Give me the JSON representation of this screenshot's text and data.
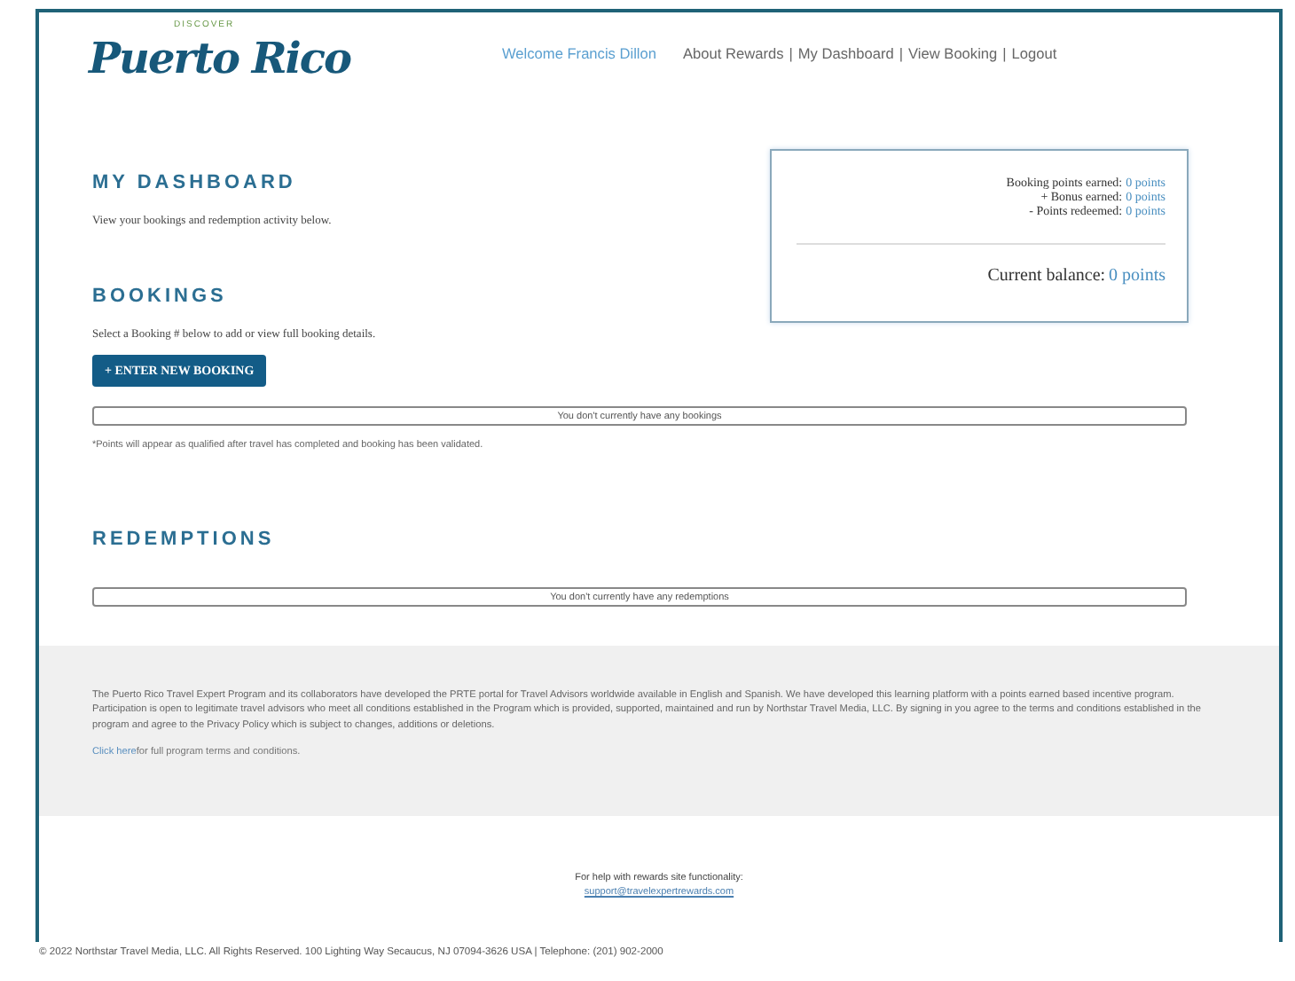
{
  "header": {
    "logo_small": "DISCOVER",
    "logo": "Puerto Rico",
    "welcome": "Welcome Francis Dillon",
    "separator": "|",
    "nav": [
      {
        "label": "About Rewards"
      },
      {
        "label": "My Dashboard"
      },
      {
        "label": "View Booking"
      },
      {
        "label": "Logout"
      }
    ]
  },
  "dashboard": {
    "title": "MY DASHBOARD",
    "text": "View your bookings and redemption activity below."
  },
  "points": {
    "rows": [
      {
        "label": "Booking points earned:",
        "value": "0 points"
      },
      {
        "label": "+ Bonus earned:",
        "value": "0 points"
      },
      {
        "label": "- Points redeemed:",
        "value": "0 points"
      }
    ],
    "balance_label": "Current balance:",
    "balance_value": "0 points"
  },
  "bookings": {
    "title": "BOOKINGS",
    "text": "Select a Booking # below to add or view full booking details.",
    "button": "+ ENTER NEW BOOKING",
    "empty": "You don't currently have any bookings",
    "note": "*Points will appear as qualified after travel has completed and booking has been validated."
  },
  "redemptions": {
    "title": "REDEMPTIONS",
    "empty": "You don't currently have any redemptions"
  },
  "footer": {
    "paragraph": "The Puerto Rico Travel Expert Program and its collaborators have developed the PRTE portal for Travel Advisors worldwide available in English and Spanish. We have developed this learning platform with a points earned based incentive program. Participation is open to legitimate travel advisors who meet all conditions established in the Program which is provided, supported, maintained and run by Northstar Travel Media, LLC. By signing in you agree to the terms and conditions established in the program and agree to the Privacy Policy which is subject to changes, additions or deletions.",
    "link": "Click here",
    "link_rest": "for full program terms and conditions.",
    "help": "For help with rewards site functionality:",
    "email": "support@travelexpertrewards.com",
    "copyright": "© 2022 Northstar Travel Media, LLC. All Rights Reserved. 100 Lighting Way Secaucus, NJ 07094-3626 USA | Telephone: (201) 902-2000"
  }
}
